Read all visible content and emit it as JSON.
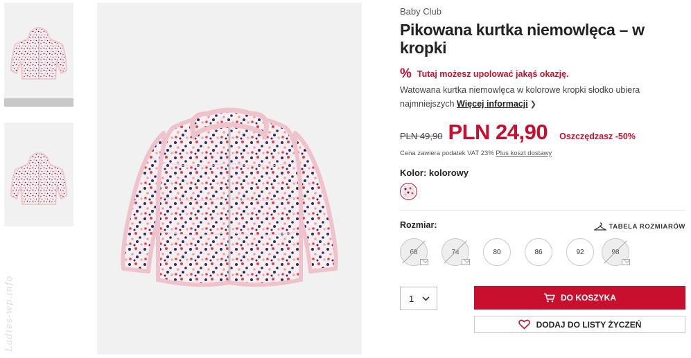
{
  "product": {
    "brand": "Baby Club",
    "title": "Pikowana kurtka niemowlęca – w kropki",
    "promo_icon": "%",
    "promo_text": "Tutaj możesz upolować jakąś okazję.",
    "description": "Watowana kurtka niemowlęca w kolorowe kropki słodko ubiera najmniejszych",
    "more_info": "Więcej informacji",
    "old_price": "PLN 49,90",
    "new_price": "PLN 24,90",
    "savings": "Oszczędzasz -50%",
    "tax_note": "Cena zawiera podatek VAT 23%",
    "shipping_link": "Plus koszt dostawy",
    "color_label": "Kolor:",
    "color_value": "kolorowy"
  },
  "sizes": {
    "label": "Rozmiar:",
    "guide_label": "TABELA ROZMIARÓW",
    "items": [
      {
        "label": "68",
        "available": false
      },
      {
        "label": "74",
        "available": false
      },
      {
        "label": "80",
        "available": true
      },
      {
        "label": "86",
        "available": true
      },
      {
        "label": "92",
        "available": true
      },
      {
        "label": "98",
        "available": false
      }
    ]
  },
  "cart": {
    "quantity": "1",
    "add_to_cart": "DO KOSZYKA",
    "wishlist": "DODAJ DO LISTY ŻYCZEŃ"
  },
  "watermark": "Ladies-wp.info",
  "colors": {
    "accent_red": "#c8102e",
    "jacket_pink": "#f0c8cf",
    "jacket_base": "#f8eef0",
    "image_bg": "#f1f1f1"
  }
}
